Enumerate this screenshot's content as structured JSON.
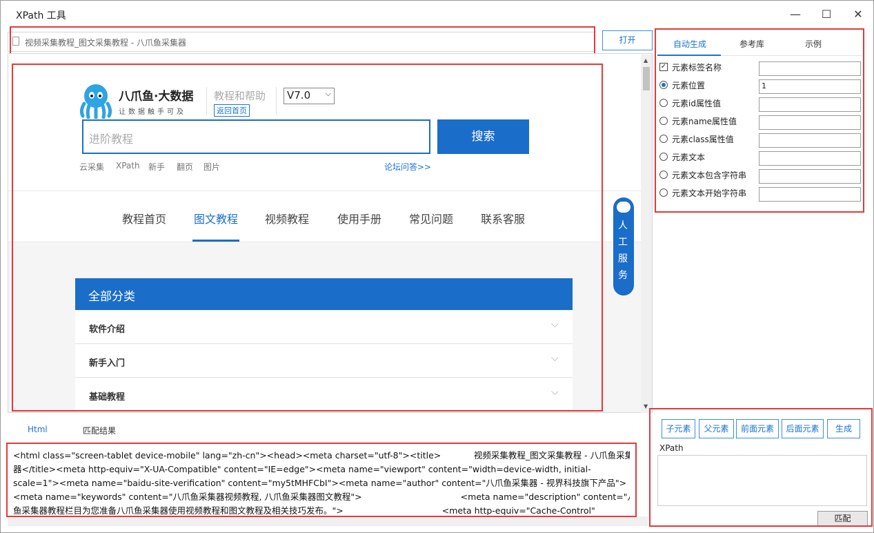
{
  "window": {
    "title": "XPath 工具",
    "minimize": "—",
    "maximize": "☐",
    "close": "✕"
  },
  "address": {
    "value": "视频采集教程_图文采集教程 - 八爪鱼采集器",
    "open_label": "打开"
  },
  "page": {
    "brand_main": "八爪鱼·大数据",
    "brand_sub": "让数据触手可及",
    "help_title": "教程和帮助",
    "back_home": "返回首页",
    "version": "V7.0",
    "search_placeholder": "进阶教程",
    "search_button": "搜索",
    "hot_tags": [
      "云采集",
      "XPath",
      "新手",
      "翻页",
      "图片"
    ],
    "forum_link": "论坛问答>>",
    "nav": [
      "教程首页",
      "图文教程",
      "视频教程",
      "使用手册",
      "常见问题",
      "联系客服"
    ],
    "active_nav": "图文教程",
    "service": [
      "人",
      "工",
      "服",
      "务"
    ],
    "category_header": "全部分类",
    "categories": [
      "软件介绍",
      "新手入门",
      "基础教程"
    ]
  },
  "right_tabs": [
    "自动生成",
    "参考库",
    "示例"
  ],
  "options": [
    {
      "label": "元素标签名称",
      "type": "checkbox",
      "checked": true,
      "value": ""
    },
    {
      "label": "元素位置",
      "type": "radio",
      "checked": true,
      "value": "1"
    },
    {
      "label": "元素id属性值",
      "type": "radio",
      "checked": false,
      "value": ""
    },
    {
      "label": "元素name属性值",
      "type": "radio",
      "checked": false,
      "value": ""
    },
    {
      "label": "元素class属性值",
      "type": "radio",
      "checked": false,
      "value": ""
    },
    {
      "label": "元素文本",
      "type": "radio",
      "checked": false,
      "value": ""
    },
    {
      "label": "元素文本包含字符串",
      "type": "radio",
      "checked": false,
      "value": ""
    },
    {
      "label": "元素文本开始字符串",
      "type": "radio",
      "checked": false,
      "value": ""
    }
  ],
  "bottom_tabs": [
    "Html",
    "匹配结果"
  ],
  "html_lines": [
    "<html class=\"screen-tablet device-mobile\" lang=\"zh-cn\"><head><meta charset=\"utf-8\"><title>            视频采集教程_图文采集教程 - 八爪鱼采集",
    "器</title><meta http-equiv=\"X-UA-Compatible\" content=\"IE=edge\"><meta name=\"viewport\" content=\"width=device-width, initial-",
    "scale=1\"><meta name=\"baidu-site-verification\" content=\"my5tMHFCbI\"><meta name=\"author\" content=\"八爪鱼采集器 - 视界科技旗下产品\">",
    "<meta name=\"keywords\" content=\"八爪鱼采集器视频教程, 八爪鱼采集器图文教程\">                                    <meta name=\"description\" content=\"八爪",
    "鱼采集器教程栏目为您准备八爪鱼采集器使用视频教程和图文教程及相关技巧发布。\">                                    <meta http-equiv=\"Cache-Control\""
  ],
  "xpath_buttons": [
    "子元素",
    "父元素",
    "前面元素",
    "后面元素",
    "生成"
  ],
  "xpath_label": "XPath",
  "xpath_value": "",
  "match_button": "匹配"
}
